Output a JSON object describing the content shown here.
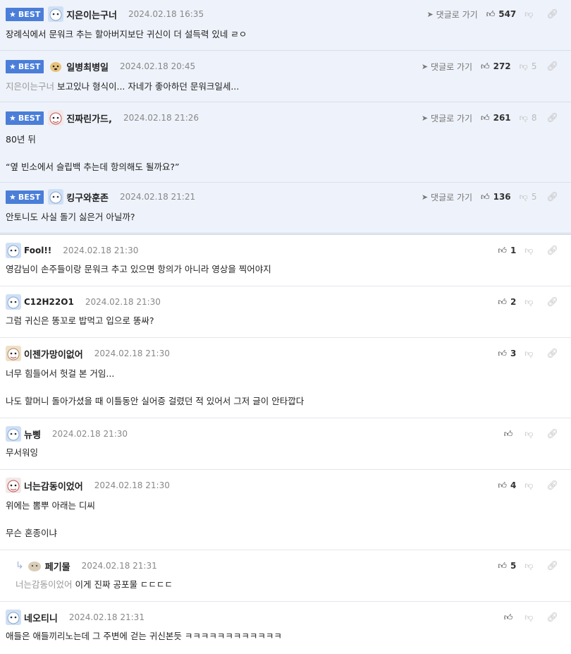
{
  "labels": {
    "best": "BEST",
    "goto_reply": "댓글로 가기"
  },
  "comments": [
    {
      "nick": "지은이는구너",
      "date": "2024.02.18 16:35",
      "likes": "547",
      "dislikes": "",
      "lines": [
        "장례식에서 문워크 추는 할아버지보단 귀신이 더 설득력 있네 ㄹㅇ"
      ]
    },
    {
      "nick": "일병최병일",
      "date": "2024.02.18 20:45",
      "likes": "272",
      "dislikes": "5",
      "mention": "지은이는구너",
      "lines": [
        "보고있나 형식이... 자네가 좋아하던 문워크일세..."
      ]
    },
    {
      "nick": "진짜린가드,",
      "date": "2024.02.18 21:26",
      "likes": "261",
      "dislikes": "8",
      "lines": [
        "80년 뒤",
        "",
        "“옆 빈소에서 슬립백 추는데 항의해도 될까요?”"
      ]
    },
    {
      "nick": "킹구와훈존",
      "date": "2024.02.18 21:21",
      "likes": "136",
      "dislikes": "5",
      "lines": [
        "안토니도 사실 돌기 싫은거 아닐까?"
      ]
    },
    {
      "nick": "Fool!!",
      "date": "2024.02.18 21:30",
      "likes": "1",
      "lines": [
        "영감님이 손주들이랑 문워크 추고 있으면 항의가 아니라 영상을 찍어야지"
      ]
    },
    {
      "nick": "C12H22O1",
      "date": "2024.02.18 21:30",
      "likes": "2",
      "lines": [
        "그럼 귀신은 똥꼬로 밥먹고 입으로 똥싸?"
      ]
    },
    {
      "nick": "이젠가망이없어",
      "date": "2024.02.18 21:30",
      "likes": "3",
      "lines": [
        "너무 힘들어서 헛걸 본 거임...",
        "",
        "나도 할머니 돌아가셨을 때 이틀동안 실어증 걸렸던 적 있어서 그저 글이 안타깝다"
      ]
    },
    {
      "nick": "뉴삥",
      "date": "2024.02.18 21:30",
      "likes": "",
      "lines": [
        "무서워잉"
      ]
    },
    {
      "nick": "너는감동이었어",
      "date": "2024.02.18 21:30",
      "likes": "4",
      "lines": [
        "위에는 뽐뿌 아래는 디씨",
        "",
        "무슨 혼종이냐"
      ]
    },
    {
      "nick": "페기물",
      "date": "2024.02.18 21:31",
      "likes": "5",
      "mention": "너는감동이었어",
      "lines": [
        "이게 진짜 공포물 ㄷㄷㄷㄷ"
      ]
    },
    {
      "nick": "네오티니",
      "date": "2024.02.18 21:31",
      "likes": "",
      "lines": [
        "애들은 애들끼리노는데 그 주변에 걷는 귀신본듯 ㅋㅋㅋㅋㅋㅋㅋㅋㅋㅋㅋㅋ"
      ]
    }
  ],
  "icons": {
    "star": "star-icon",
    "paper_plane": "paper-plane-icon",
    "thumb_up": "thumb-up-icon",
    "thumb_down": "thumb-down-icon",
    "link": "link-icon",
    "reply_arrow": "reply-arrow-icon"
  },
  "colors": {
    "best_badge": "#4a7ed8",
    "best_bg": "#eef2fa",
    "mention": "#999999",
    "date": "#888888"
  }
}
